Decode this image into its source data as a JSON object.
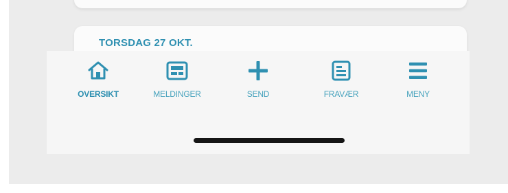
{
  "feed": {
    "day_heading": "TORSDAG 27 OKT."
  },
  "nav": {
    "items": [
      {
        "label": "OVERSIKT",
        "icon": "home-icon",
        "active": true
      },
      {
        "label": "MELDINGER",
        "icon": "messages-icon",
        "active": false
      },
      {
        "label": "SEND",
        "icon": "plus-icon",
        "active": false
      },
      {
        "label": "FRAVÆR",
        "icon": "absence-form-icon",
        "active": false
      },
      {
        "label": "MENY",
        "icon": "hamburger-menu-icon",
        "active": false
      }
    ]
  },
  "colors": {
    "accent": "#2f90b1",
    "nav_background": "#f6f6f6",
    "screen_background": "#ececec",
    "card_background": "#fbfbfb",
    "home_indicator": "#151515"
  }
}
